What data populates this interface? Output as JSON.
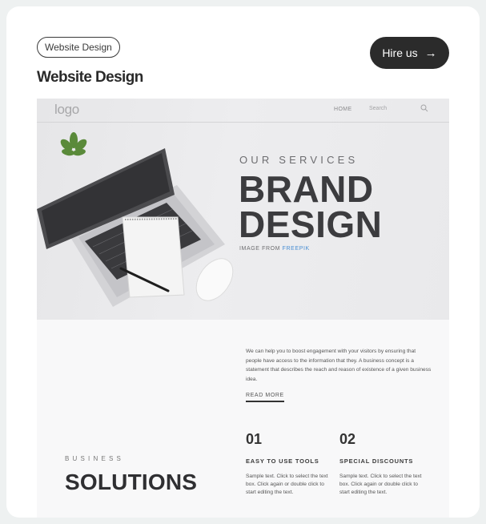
{
  "card": {
    "tag": "Website Design",
    "title": "Website Design",
    "hire_label": "Hire us",
    "hire_arrow": "→"
  },
  "preview": {
    "logo": "logo",
    "nav": {
      "home": "HOME",
      "search_placeholder": "Search"
    },
    "hero": {
      "kicker": "OUR SERVICES",
      "headline_1": "BRAND",
      "headline_2": "DESIGN",
      "credit_prefix": "IMAGE FROM ",
      "credit_link": "FREEPIK"
    },
    "body_text": "We can help you to boost engagement with your visitors by ensuring that people have access to the information that they. A business concept is a statement that describes the reach and reason of existence of a given business idea.",
    "read_more": "READ MORE",
    "section_kicker": "BUSINESS",
    "section_title": "SOLUTIONS",
    "features": [
      {
        "num": "01",
        "title": "EASY TO USE TOOLS",
        "desc": "Sample text. Click to select the text box. Click again or double click to start editing the text."
      },
      {
        "num": "02",
        "title": "SPECIAL DISCOUNTS",
        "desc": "Sample text. Click to select the text box. Click again or double click to start editing the text."
      }
    ]
  },
  "colors": {
    "accent": "#2b2b2b",
    "link": "#4a8fd4",
    "background": "#eef1f1"
  }
}
